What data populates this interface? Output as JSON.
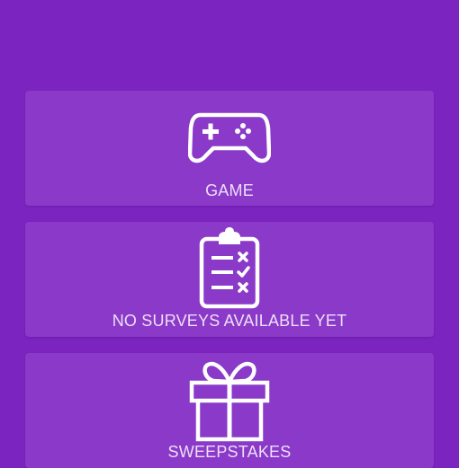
{
  "menu": {
    "items": [
      {
        "label": "GAME",
        "icon": "gamepad-icon"
      },
      {
        "label": "NO SURVEYS AVAILABLE YET",
        "icon": "clipboard-checklist-icon"
      },
      {
        "label": "SWEEPSTAKES",
        "icon": "gift-icon"
      }
    ]
  },
  "colors": {
    "background": "#7c24c0",
    "card": "#8a39c8",
    "text": "#eddff8",
    "icon": "#ffffff"
  }
}
